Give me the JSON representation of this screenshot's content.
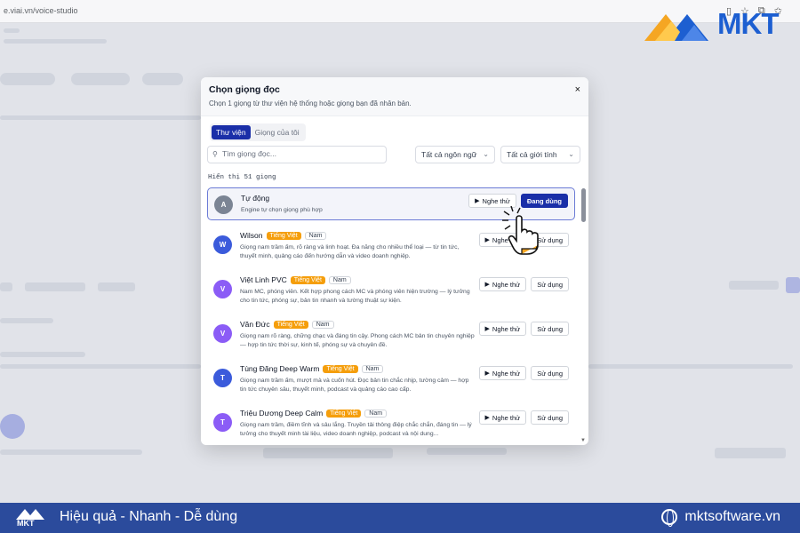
{
  "browser": {
    "url": "e.viai.vn/voice-studio"
  },
  "logo": {
    "text": "MKT"
  },
  "modal": {
    "title": "Chọn giọng đọc",
    "subtitle": "Chọn 1 giọng từ thư viện hệ thống hoặc giọng bạn đã nhân bản.",
    "close_label": "×",
    "tabs": [
      {
        "label": "Thư viện",
        "active": true
      },
      {
        "label": "Giọng của tôi",
        "active": false
      }
    ],
    "search": {
      "placeholder": "Tìm giọng đọc...",
      "value": ""
    },
    "language_filter": "Tất cả ngôn ngữ",
    "gender_filter": "Tất cả giới tính",
    "count_text": "Hiển thị 51 giọng",
    "voices": [
      {
        "initial": "A",
        "name": "Tự động",
        "language": "",
        "gender": "",
        "description": "Engine tự chọn giọng phù hợp",
        "preview_label": "Nghe thử",
        "action_label": "Đang dùng",
        "selected": true,
        "avatar_color": "#7b8494"
      },
      {
        "initial": "W",
        "name": "Wilson",
        "language": "Tiếng Việt",
        "gender": "Nam",
        "description": "Giọng nam trầm ấm, rõ ràng và linh hoạt. Đa năng cho nhiều thể loại — từ tin tức, thuyết minh, quảng cáo đến hướng dẫn và video doanh nghiệp.",
        "preview_label": "Nghe thử",
        "action_label": "Sử dụng",
        "selected": false,
        "avatar_color": "#3b5bdb"
      },
      {
        "initial": "V",
        "name": "Việt Linh PVC",
        "language": "Tiếng Việt",
        "gender": "Nam",
        "description": "Nam MC, phóng viên. Kết hợp phong cách MC và phóng viên hiện trường — lý tưởng cho tin tức, phóng sự, bản tin nhanh và tường thuật sự kiện.",
        "preview_label": "Nghe thử",
        "action_label": "Sử dụng",
        "selected": false,
        "avatar_color": "#8b5cf6"
      },
      {
        "initial": "V",
        "name": "Văn Đức",
        "language": "Tiếng Việt",
        "gender": "Nam",
        "description": "Giọng nam rõ ràng, chững chạc và đáng tin cậy. Phong cách MC bản tin chuyên nghiệp — hợp tin tức thời sự, kinh tế, phóng sự và chuyên đề.",
        "preview_label": "Nghe thử",
        "action_label": "Sử dụng",
        "selected": false,
        "avatar_color": "#8b5cf6"
      },
      {
        "initial": "T",
        "name": "Tùng Đăng Deep Warm",
        "language": "Tiếng Việt",
        "gender": "Nam",
        "description": "Giọng nam trầm ấm, mượt mà và cuốn hút. Đọc bản tin chắc nhịp, tường cảm — hợp tin tức chuyên sâu, thuyết minh, podcast và quảng cáo cao cấp.",
        "preview_label": "Nghe thử",
        "action_label": "Sử dụng",
        "selected": false,
        "avatar_color": "#3b5bdb"
      },
      {
        "initial": "T",
        "name": "Triệu Dương Deep Calm",
        "language": "Tiếng Việt",
        "gender": "Nam",
        "description": "Giọng nam trầm, điềm tĩnh và sâu lắng. Truyền tải thông điệp chắc chắn, đáng tin — lý tưởng cho thuyết minh tài liệu, video doanh nghiệp, podcast và nội dung...",
        "preview_label": "Nghe thử",
        "action_label": "Sử dụng",
        "selected": false,
        "avatar_color": "#8b5cf6"
      }
    ]
  },
  "footer": {
    "slogan": "Hiệu quả - Nhanh - Dễ dùng",
    "website": "mktsoftware.vn",
    "logo_text": "MKT"
  },
  "colors": {
    "primary": "#1a2fa8",
    "tag_orange": "#f59e0b",
    "footer_bg": "#2b4b9c",
    "logo_blue": "#1d5fd1",
    "logo_orange": "#f5a623"
  }
}
